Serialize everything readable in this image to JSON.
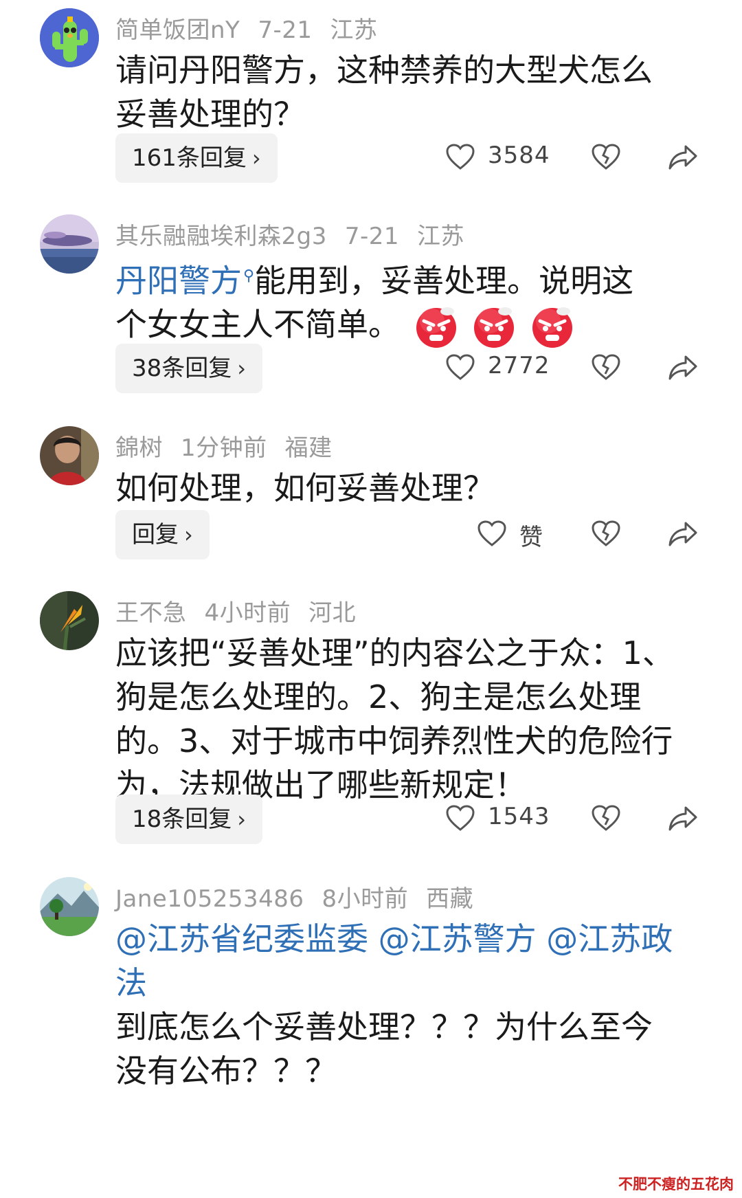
{
  "comments": [
    {
      "username": "简单饭团nY",
      "time": "7-21",
      "location": "江苏",
      "avatar": "cactus-avatar",
      "text_lines": [
        "请问丹阳警方，这种禁养的大型犬怎么",
        "妥善处理的？"
      ],
      "replies": "161条回复",
      "likes": "3584"
    },
    {
      "username": "其乐融融埃利森2g3",
      "time": "7-21",
      "location": "江苏",
      "avatar": "sunset-avatar",
      "mention": "丹阳警方",
      "text_after_mention": "能用到，妥善处理。说明这",
      "text_line2": "个女女主人不简单。",
      "emojis": [
        "angry-face-emoji",
        "angry-face-emoji",
        "angry-face-emoji"
      ],
      "replies": "38条回复",
      "likes": "2772"
    },
    {
      "username": "錦树",
      "time": "1分钟前",
      "location": "福建",
      "avatar": "child-photo-avatar",
      "text_lines": [
        "如何处理，如何妥善处理？"
      ],
      "replies": "回复",
      "likes": "赞"
    },
    {
      "username": "王不急",
      "time": "4小时前",
      "location": "河北",
      "avatar": "bird-of-paradise-avatar",
      "text_lines": [
        "应该把“妥善处理”的内容公之于众：1、",
        "狗是怎么处理的。2、狗主是怎么处理",
        "的。3、对于城市中饲养烈性犬的危险行",
        "为，法规做出了哪些新规定！"
      ],
      "replies": "18条回复",
      "likes": "1543"
    },
    {
      "username": "Jane105253486",
      "time": "8小时前",
      "location": "西藏",
      "avatar": "landscape-avatar",
      "mention_lines": [
        "@江苏省纪委监委 @江苏警方 @江苏政",
        "法"
      ],
      "text_lines": [
        "到底怎么个妥善处理？？？为什么至今",
        "没有公布？？？"
      ]
    }
  ],
  "icons": {
    "like": "heart-outline-icon",
    "dislike": "broken-heart-icon",
    "share": "share-arrow-icon",
    "chevron": "chevron-right-icon"
  },
  "chevron_glyph": "›",
  "watermark": "不肥不瘦的五花肉",
  "colors": {
    "mention": "#2f6fb6",
    "meta": "#9a9a9a",
    "reply_bg": "#f2f2f2"
  }
}
